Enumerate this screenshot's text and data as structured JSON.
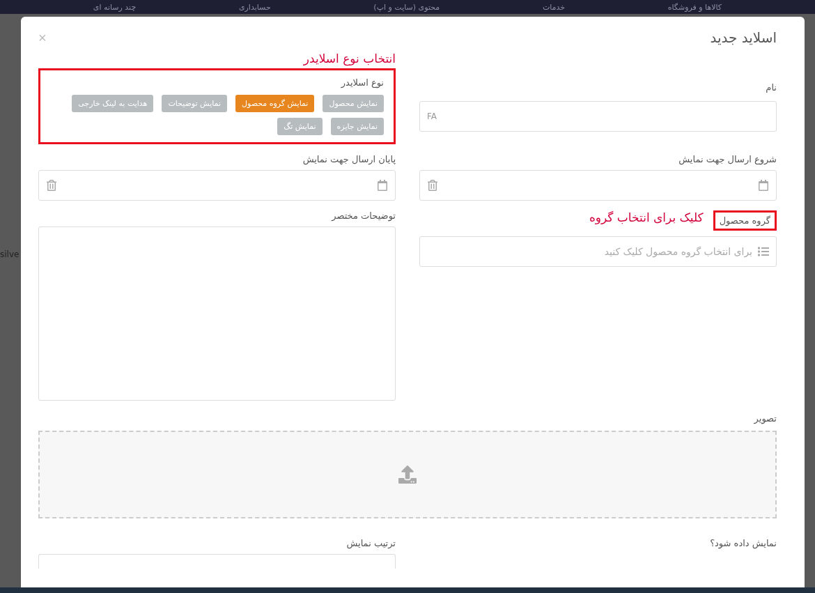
{
  "backdrop": {
    "nav_items": [
      "کالاها و فروشگاه",
      "خدمات",
      "محتوی (سایت و اپ)",
      "حسابداری",
      "چند رسانه ای"
    ],
    "side_fragment": "silve"
  },
  "modal": {
    "title": "اسلاید جدید",
    "close": "×"
  },
  "name_field": {
    "label": "نام",
    "lang_tag": "FA"
  },
  "slider_type": {
    "annotation": "انتخاب نوع اسلایدر",
    "highlighted": true,
    "label": "نوع اسلایدر",
    "options": [
      {
        "label": "نمایش محصول",
        "selected": false
      },
      {
        "label": "نمایش گروه محصول",
        "selected": true
      },
      {
        "label": "نمایش توضیحات",
        "selected": false
      },
      {
        "label": "هدایت به لینک خارجی",
        "selected": false
      },
      {
        "label": "نمایش جایزه",
        "selected": false
      },
      {
        "label": "نمایش تگ",
        "selected": false
      }
    ]
  },
  "start_date": {
    "label": "شروع ارسال جهت نمایش"
  },
  "end_date": {
    "label": "پایان ارسال جهت نمایش"
  },
  "product_group": {
    "label": "گروه محصول",
    "highlighted": true,
    "annotation": "کلیک برای انتخاب گروه",
    "placeholder": "برای انتخاب گروه محصول کلیک کنید"
  },
  "short_description": {
    "label": "توضیحات مختصر"
  },
  "image": {
    "label": "تصویر"
  },
  "visible": {
    "label": "نمایش داده شود؟"
  },
  "display_order": {
    "label": "ترتیب نمایش"
  }
}
